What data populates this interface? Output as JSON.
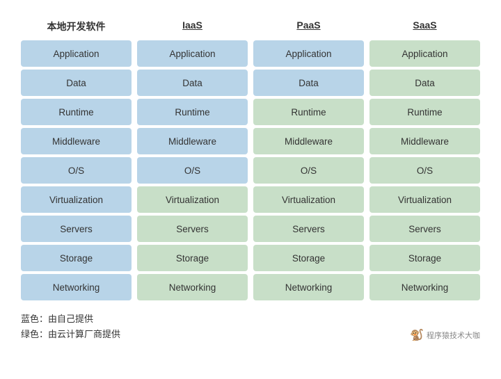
{
  "headers": [
    {
      "label": "本地开发软件",
      "underline": false
    },
    {
      "label": "IaaS",
      "underline": true
    },
    {
      "label": "PaaS",
      "underline": true
    },
    {
      "label": "SaaS",
      "underline": true
    }
  ],
  "rows": [
    "Application",
    "Data",
    "Runtime",
    "Middleware",
    "O/S",
    "Virtualization",
    "Servers",
    "Storage",
    "Networking"
  ],
  "columns": [
    {
      "key": "on-prem",
      "cells": [
        {
          "color": "blue"
        },
        {
          "color": "blue"
        },
        {
          "color": "blue"
        },
        {
          "color": "blue"
        },
        {
          "color": "blue"
        },
        {
          "color": "blue"
        },
        {
          "color": "blue"
        },
        {
          "color": "blue"
        },
        {
          "color": "blue"
        }
      ]
    },
    {
      "key": "iaas",
      "cells": [
        {
          "color": "blue"
        },
        {
          "color": "blue"
        },
        {
          "color": "blue"
        },
        {
          "color": "blue"
        },
        {
          "color": "blue"
        },
        {
          "color": "green"
        },
        {
          "color": "green"
        },
        {
          "color": "green"
        },
        {
          "color": "green"
        }
      ]
    },
    {
      "key": "paas",
      "cells": [
        {
          "color": "blue"
        },
        {
          "color": "blue"
        },
        {
          "color": "green"
        },
        {
          "color": "green"
        },
        {
          "color": "green"
        },
        {
          "color": "green"
        },
        {
          "color": "green"
        },
        {
          "color": "green"
        },
        {
          "color": "green"
        }
      ]
    },
    {
      "key": "saas",
      "cells": [
        {
          "color": "green"
        },
        {
          "color": "green"
        },
        {
          "color": "green"
        },
        {
          "color": "green"
        },
        {
          "color": "green"
        },
        {
          "color": "green"
        },
        {
          "color": "green"
        },
        {
          "color": "green"
        },
        {
          "color": "green"
        }
      ]
    }
  ],
  "legend": {
    "blue_label": "蓝色：由自己提供",
    "green_label": "绿色：由云计算厂商提供"
  },
  "watermark": {
    "icon": "🐒",
    "text": "程序猿技术大咖"
  }
}
